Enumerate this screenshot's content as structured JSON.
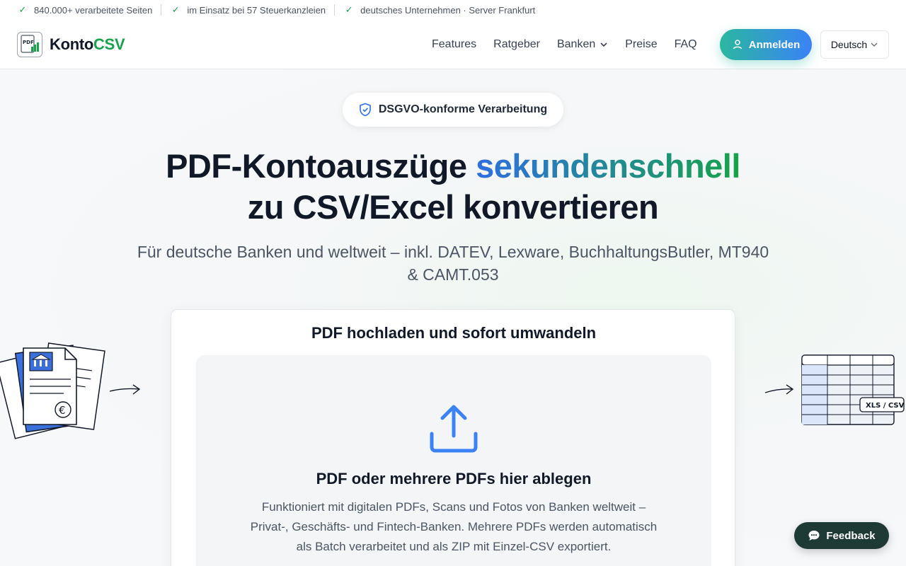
{
  "trustbar": {
    "items": [
      "840.000+ verarbeitete Seiten",
      "im Einsatz bei 57 Steuerkanzleien",
      "deutsches Unternehmen · Server Frankfurt"
    ]
  },
  "header": {
    "logo_prefix": "Konto",
    "logo_accent": "CSV",
    "logo_icon_text": "PDF",
    "nav": [
      "Features",
      "Ratgeber",
      "Banken",
      "Preise",
      "FAQ"
    ],
    "login_label": "Anmelden",
    "language_selected": "Deutsch"
  },
  "hero": {
    "badge": "DSGVO-konforme Verarbeitung",
    "headline_part1": "PDF-Kontoauszüge ",
    "headline_highlight": "sekundenschnell",
    "headline_line2": "zu CSV/Excel konvertieren",
    "subline": "Für deutsche Banken und weltweit – inkl. DATEV, Lexware, BuchhaltungsButler, MT940 & CAMT.053"
  },
  "upload": {
    "card_title": "PDF hochladen und sofort umwandeln",
    "drop_title": "PDF oder mehrere PDFs hier ablegen",
    "drop_text": "Funktioniert mit digitalen PDFs, Scans und Fotos von Banken weltweit – Privat-, Geschäfts- und Fintech-Banken. Mehrere PDFs werden automatisch als Batch verarbeitet und als ZIP mit Einzel-CSV exportiert."
  },
  "illustration": {
    "output_tag": "XLS / CSV",
    "currency_symbol": "€"
  },
  "feedback_label": "Feedback",
  "colors": {
    "brand_green": "#16a34a",
    "brand_blue": "#2f6fe0",
    "login_gradient_start": "#2bb7a0",
    "login_gradient_end": "#3b82f6",
    "feedback_bg": "#1e3a34"
  }
}
